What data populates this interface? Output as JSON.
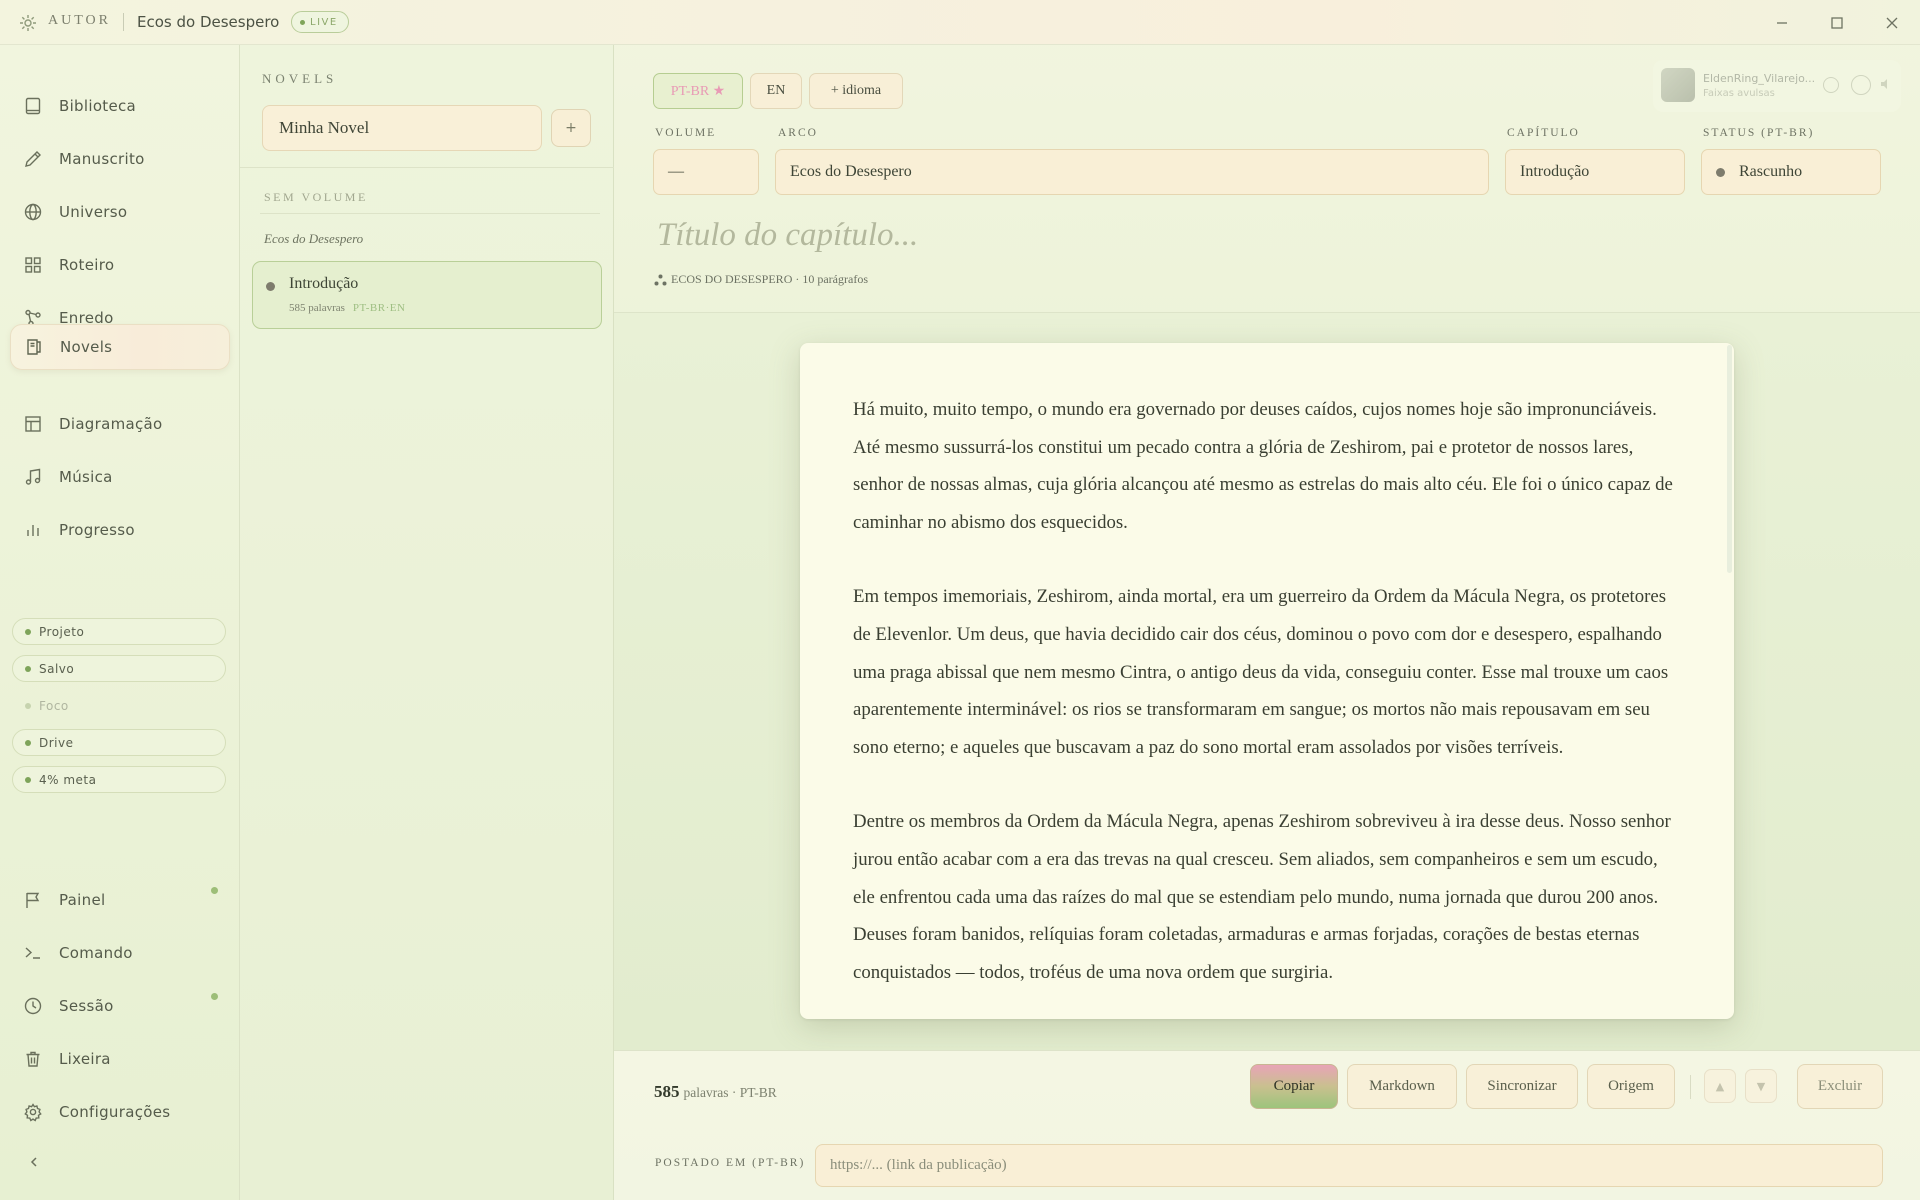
{
  "app": {
    "brand": "AUTOR",
    "window_title": "Ecos do Desespero",
    "live_badge": "LIVE"
  },
  "sidebar": {
    "nav": [
      {
        "label": "Biblioteca",
        "icon": "book-icon"
      },
      {
        "label": "Manuscrito",
        "icon": "pen-icon"
      },
      {
        "label": "Universo",
        "icon": "globe-icon"
      },
      {
        "label": "Roteiro",
        "icon": "grid-icon"
      },
      {
        "label": "Enredo",
        "icon": "branch-icon"
      },
      {
        "label": "Novels",
        "icon": "novel-icon",
        "active": true
      },
      {
        "label": "Diagramação",
        "icon": "layout-icon"
      },
      {
        "label": "Música",
        "icon": "music-icon"
      },
      {
        "label": "Progresso",
        "icon": "bar-chart-icon"
      }
    ],
    "status_pills": [
      {
        "label": "Projeto",
        "active": true
      },
      {
        "label": "Salvo",
        "active": true
      },
      {
        "label": "Foco",
        "active": false
      },
      {
        "label": "Drive",
        "active": true
      },
      {
        "label": "4% meta",
        "active": true
      }
    ],
    "bottom_nav": [
      {
        "label": "Painel",
        "icon": "flag-icon",
        "notification": true
      },
      {
        "label": "Comando",
        "icon": "terminal-icon",
        "notification": false
      },
      {
        "label": "Sessão",
        "icon": "clock-icon",
        "notification": true
      },
      {
        "label": "Lixeira",
        "icon": "trash-icon",
        "notification": false
      },
      {
        "label": "Configurações",
        "icon": "gear-icon",
        "notification": false
      }
    ]
  },
  "novels_panel": {
    "heading": "NOVELS",
    "novel_name": "Minha Novel",
    "add_label": "+",
    "volume_heading": "SEM VOLUME",
    "arc_name": "Ecos do Desespero",
    "chapter": {
      "title": "Introdução",
      "words": "585 palavras",
      "langs": "PT-BR·EN"
    }
  },
  "editor": {
    "languages": [
      {
        "label": "PT-BR ★",
        "active": true
      },
      {
        "label": "EN",
        "active": false
      },
      {
        "label": "+ idioma",
        "active": false
      }
    ],
    "player": {
      "track": "EldenRing_Vilarejo...",
      "sub": "Faixas avulsas"
    },
    "fields": {
      "volume_label": "VOLUME",
      "volume_value": "—",
      "arc_label": "ARCO",
      "arc_value": "Ecos do Desespero",
      "chapter_label": "CAPÍTULO",
      "chapter_value": "Introdução",
      "status_label": "STATUS (PT-BR)",
      "status_value": "Rascunho"
    },
    "title_placeholder": "Título do capítulo...",
    "arc_meta": "ECOS DO DESESPERO · 10 parágrafos",
    "paragraphs": [
      "Há muito, muito tempo, o mundo era governado por deuses caídos, cujos nomes hoje são impronunciáveis. Até mesmo sussurrá-los constitui um pecado contra a glória de Zeshirom, pai e protetor de nossos lares, senhor de nossas almas, cuja glória alcançou até mesmo as estrelas do mais alto céu. Ele foi o único capaz de caminhar no abismo dos esquecidos.",
      "Em tempos imemoriais, Zeshirom, ainda mortal, era um guerreiro da Ordem da Mácula Negra, os protetores de Elevenlor. Um deus, que havia decidido cair dos céus, dominou o povo com dor e desespero, espalhando uma praga abissal que nem mesmo Cintra, o antigo deus da vida, conseguiu conter. Esse mal trouxe um caos aparentemente interminável: os rios se transformaram em sangue; os mortos não mais repousavam em seu sono eterno; e aqueles que buscavam a paz do sono mortal eram assolados por visões terríveis.",
      "Dentre os membros da Ordem da Mácula Negra, apenas Zeshirom sobreviveu à ira desse deus. Nosso senhor jurou então acabar com a era das trevas na qual cresceu. Sem aliados, sem companheiros e sem um escudo, ele enfrentou cada uma das raízes do mal que se estendiam pelo mundo, numa jornada que durou 200 anos. Deuses foram banidos, relíquias foram coletadas, armaduras e armas forjadas, corações de bestas eternas conquistados — todos, troféus de uma nova ordem que surgiria."
    ]
  },
  "bottom_bar": {
    "word_count": "585",
    "word_suffix": "palavras · PT-BR",
    "actions": {
      "copy": "Copiar",
      "markdown": "Markdown",
      "sync": "Sincronizar",
      "origin": "Origem",
      "delete": "Excluir"
    },
    "posted_label": "POSTADO EM (PT-BR)",
    "posted_placeholder": "https://... (link da publicação)"
  }
}
